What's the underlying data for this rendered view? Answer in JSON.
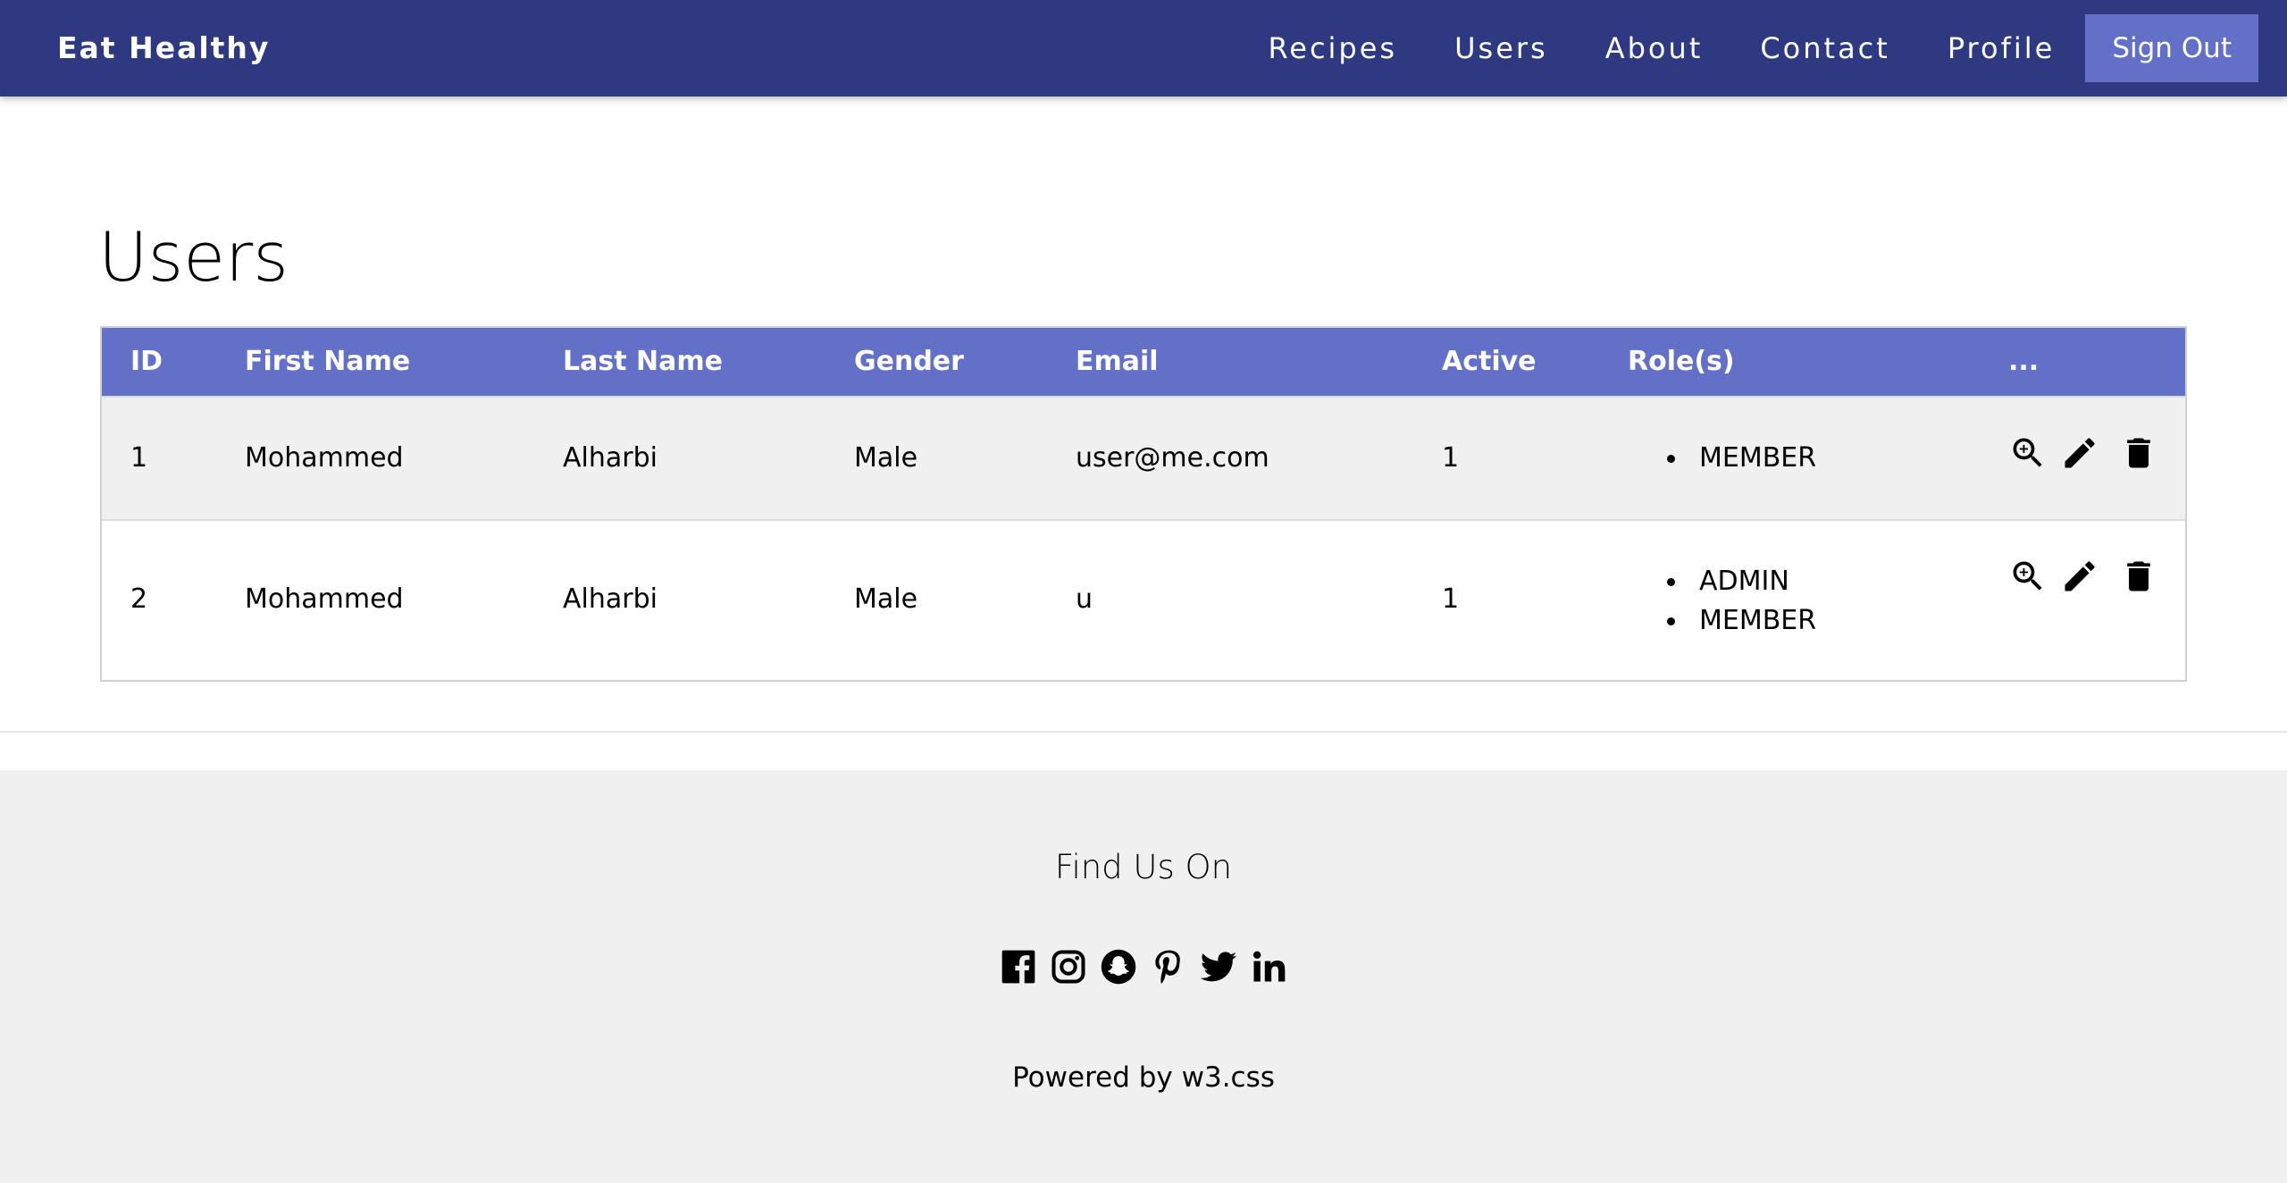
{
  "nav": {
    "brand": "Eat Healthy",
    "links": [
      "Recipes",
      "Users",
      "About",
      "Contact",
      "Profile"
    ],
    "signout": "Sign Out"
  },
  "main": {
    "title": "Users",
    "columns": [
      "ID",
      "First Name",
      "Last Name",
      "Gender",
      "Email",
      "Active",
      "Role(s)",
      "..."
    ],
    "rows": [
      {
        "id": "1",
        "first": "Mohammed",
        "last": "Alharbi",
        "gender": "Male",
        "email": "user@me.com",
        "active": "1",
        "roles": [
          "MEMBER"
        ]
      },
      {
        "id": "2",
        "first": "Mohammed",
        "last": "Alharbi",
        "gender": "Male",
        "email": "u",
        "active": "1",
        "roles": [
          "ADMIN",
          "MEMBER"
        ]
      }
    ],
    "row_actions": [
      "zoom-in-icon",
      "pencil-icon",
      "trash-icon"
    ]
  },
  "footer": {
    "find_us": "Find Us On",
    "socials": [
      "facebook-icon",
      "instagram-icon",
      "snapchat-icon",
      "pinterest-icon",
      "twitter-icon",
      "linkedin-icon"
    ],
    "powered_prefix": "Powered by ",
    "powered_link": "w3.css"
  },
  "colors": {
    "navbar": "#2e3981",
    "accent": "#6270c8",
    "row_alt": "#f0f0f0",
    "footer_bg": "#f0f0f0"
  }
}
